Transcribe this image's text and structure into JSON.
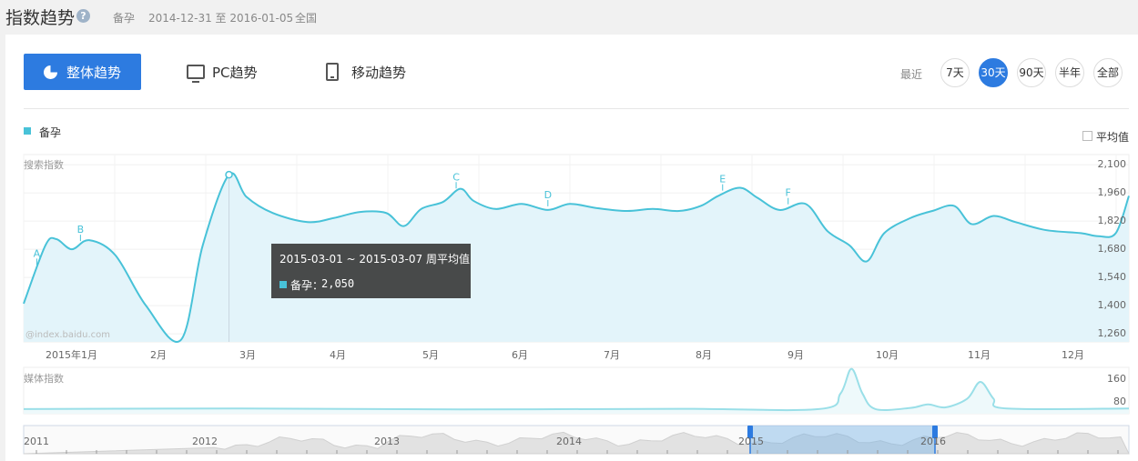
{
  "header": {
    "title": "指数趋势",
    "keyword": "备孕",
    "date_range": "2014-12-31 至 2016-01-05",
    "region": "全国"
  },
  "tabs": [
    {
      "label": "整体趋势",
      "icon": "pie-chart-icon",
      "active": true
    },
    {
      "label": "PC趋势",
      "icon": "monitor-icon",
      "active": false
    },
    {
      "label": "移动趋势",
      "icon": "phone-icon",
      "active": false
    }
  ],
  "range": {
    "label": "最近",
    "options": [
      "7天",
      "30天",
      "90天",
      "半年",
      "全部"
    ],
    "selected": "30天"
  },
  "legend": {
    "series": "备孕",
    "color": "#48c2d8"
  },
  "average_toggle": "平均值",
  "watermark": "@index.baidu.com",
  "tooltip": {
    "title": "2015-03-01 ~ 2015-03-07 周平均值",
    "series": "备孕：",
    "value": "2,050"
  },
  "chart_data": [
    {
      "type": "area",
      "ylabel": "搜索指数",
      "yticks": [
        "2,100",
        "1,960",
        "1,820",
        "1,680",
        "1,540",
        "1,400",
        "1,260"
      ],
      "xticks": [
        "2015年1月",
        "2月",
        "3月",
        "4月",
        "5月",
        "6月",
        "7月",
        "8月",
        "9月",
        "10月",
        "11月",
        "12月"
      ],
      "ylim": [
        1220,
        2150
      ],
      "series": [
        {
          "points": [
            [
              0.0,
              1410
            ],
            [
              0.5,
              1700
            ],
            [
              0.75,
              1730
            ],
            [
              1.1,
              1680
            ],
            [
              1.5,
              1725
            ],
            [
              2.1,
              1650
            ],
            [
              2.8,
              1400
            ],
            [
              3.6,
              1230
            ],
            [
              4.1,
              1700
            ],
            [
              4.7,
              2050
            ],
            [
              5.1,
              1940
            ],
            [
              5.7,
              1860
            ],
            [
              6.5,
              1815
            ],
            [
              7.1,
              1835
            ],
            [
              7.7,
              1865
            ],
            [
              8.3,
              1860
            ],
            [
              8.7,
              1795
            ],
            [
              9.1,
              1880
            ],
            [
              9.6,
              1915
            ],
            [
              10.0,
              1980
            ],
            [
              10.3,
              1920
            ],
            [
              10.8,
              1880
            ],
            [
              11.4,
              1905
            ],
            [
              12.0,
              1875
            ],
            [
              12.5,
              1905
            ],
            [
              13.1,
              1885
            ],
            [
              13.8,
              1870
            ],
            [
              14.4,
              1880
            ],
            [
              15.0,
              1870
            ],
            [
              15.5,
              1895
            ],
            [
              15.9,
              1945
            ],
            [
              16.4,
              1985
            ],
            [
              16.8,
              1935
            ],
            [
              17.3,
              1875
            ],
            [
              17.9,
              1905
            ],
            [
              18.4,
              1770
            ],
            [
              18.9,
              1700
            ],
            [
              19.3,
              1620
            ],
            [
              19.7,
              1760
            ],
            [
              20.3,
              1835
            ],
            [
              20.8,
              1870
            ],
            [
              21.3,
              1895
            ],
            [
              21.7,
              1805
            ],
            [
              22.2,
              1845
            ],
            [
              22.7,
              1815
            ],
            [
              23.4,
              1775
            ],
            [
              24.2,
              1760
            ],
            [
              24.6,
              1745
            ],
            [
              25.0,
              1760
            ],
            [
              25.3,
              1945
            ]
          ]
        }
      ],
      "markers": [
        {
          "label": "A",
          "x": 0.3
        },
        {
          "label": "B",
          "x": 1.3
        },
        {
          "label": "C",
          "x": 9.9
        },
        {
          "label": "D",
          "x": 12.0
        },
        {
          "label": "E",
          "x": 16.0
        },
        {
          "label": "F",
          "x": 17.5
        }
      ],
      "highlight": {
        "x": 4.7,
        "value": 2050
      }
    },
    {
      "type": "area",
      "ylabel": "媒体指数",
      "yticks": [
        "160",
        "80"
      ],
      "ylim": [
        40,
        200
      ],
      "series": [
        {
          "points": [
            [
              0,
              56
            ],
            [
              5,
              58
            ],
            [
              10,
              55
            ],
            [
              15,
              57
            ],
            [
              18.2,
              56
            ],
            [
              18.7,
              110
            ],
            [
              18.95,
              195
            ],
            [
              19.2,
              110
            ],
            [
              19.5,
              56
            ],
            [
              20.3,
              60
            ],
            [
              20.7,
              72
            ],
            [
              21.1,
              62
            ],
            [
              21.6,
              92
            ],
            [
              21.9,
              150
            ],
            [
              22.2,
              92
            ],
            [
              22.5,
              58
            ],
            [
              25.3,
              58
            ]
          ]
        }
      ]
    }
  ],
  "navigator": {
    "years": [
      "2011",
      "2012",
      "2013",
      "2014",
      "2015",
      "2016"
    ]
  }
}
